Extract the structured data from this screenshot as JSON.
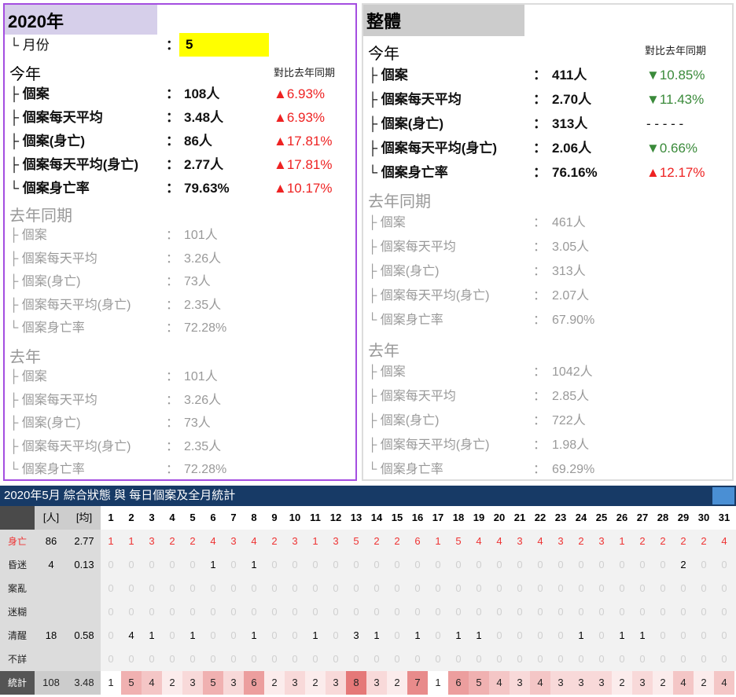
{
  "left": {
    "title": "2020年",
    "month_label": "└ 月份",
    "month_value": "5",
    "this_year": {
      "header": "今年",
      "compare_header": "對比去年同期",
      "rows": [
        {
          "label": "├ 個案",
          "value": "108人",
          "cmp": "▲6.93%",
          "dir": "up"
        },
        {
          "label": "├ 個案每天平均",
          "value": "3.48人",
          "cmp": "▲6.93%",
          "dir": "up"
        },
        {
          "label": "├ 個案(身亡)",
          "value": "86人",
          "cmp": "▲17.81%",
          "dir": "up"
        },
        {
          "label": "├ 個案每天平均(身亡)",
          "value": "2.77人",
          "cmp": "▲17.81%",
          "dir": "up"
        },
        {
          "label": "└ 個案身亡率",
          "value": "79.63%",
          "cmp": "▲10.17%",
          "dir": "up"
        }
      ]
    },
    "same_period": {
      "header": "去年同期",
      "rows": [
        {
          "label": "├ 個案",
          "value": "101人"
        },
        {
          "label": "├ 個案每天平均",
          "value": "3.26人"
        },
        {
          "label": "├ 個案(身亡)",
          "value": "73人"
        },
        {
          "label": "├ 個案每天平均(身亡)",
          "value": "2.35人"
        },
        {
          "label": "└ 個案身亡率",
          "value": "72.28%"
        }
      ]
    },
    "last_year": {
      "header": "去年",
      "rows": [
        {
          "label": "├ 個案",
          "value": "101人"
        },
        {
          "label": "├ 個案每天平均",
          "value": "3.26人"
        },
        {
          "label": "├ 個案(身亡)",
          "value": "73人"
        },
        {
          "label": "├ 個案每天平均(身亡)",
          "value": "2.35人"
        },
        {
          "label": "└ 個案身亡率",
          "value": "72.28%"
        }
      ]
    }
  },
  "right": {
    "title": "整體",
    "this_year": {
      "header": "今年",
      "compare_header": "對比去年同期",
      "rows": [
        {
          "label": "├ 個案",
          "value": "411人",
          "cmp": "▼10.85%",
          "dir": "down"
        },
        {
          "label": "├ 個案每天平均",
          "value": "2.70人",
          "cmp": "▼11.43%",
          "dir": "down"
        },
        {
          "label": "├ 個案(身亡)",
          "value": "313人",
          "cmp": "- - - - -",
          "dir": "dash"
        },
        {
          "label": "├ 個案每天平均(身亡)",
          "value": "2.06人",
          "cmp": "▼0.66%",
          "dir": "down"
        },
        {
          "label": "└ 個案身亡率",
          "value": "76.16%",
          "cmp": "▲12.17%",
          "dir": "up"
        }
      ]
    },
    "same_period": {
      "header": "去年同期",
      "rows": [
        {
          "label": "├ 個案",
          "value": "461人"
        },
        {
          "label": "├ 個案每天平均",
          "value": "3.05人"
        },
        {
          "label": "├ 個案(身亡)",
          "value": "313人"
        },
        {
          "label": "├ 個案每天平均(身亡)",
          "value": "2.07人"
        },
        {
          "label": "└ 個案身亡率",
          "value": "67.90%"
        }
      ]
    },
    "last_year": {
      "header": "去年",
      "rows": [
        {
          "label": "├ 個案",
          "value": "1042人"
        },
        {
          "label": "├ 個案每天平均",
          "value": "2.85人"
        },
        {
          "label": "├ 個案(身亡)",
          "value": "722人"
        },
        {
          "label": "├ 個案每天平均(身亡)",
          "value": "1.98人"
        },
        {
          "label": "└ 個案身亡率",
          "value": "69.29%"
        }
      ]
    }
  },
  "colon": "：",
  "table": {
    "title": "2020年5月 綜合狀態 與 每日個案及全月統計",
    "col_people": "[人]",
    "col_avg": "[均]",
    "days": [
      "1",
      "2",
      "3",
      "4",
      "5",
      "6",
      "7",
      "8",
      "9",
      "10",
      "11",
      "12",
      "13",
      "14",
      "15",
      "16",
      "17",
      "18",
      "19",
      "20",
      "21",
      "22",
      "23",
      "24",
      "25",
      "26",
      "27",
      "28",
      "29",
      "30",
      "31"
    ],
    "rows": [
      {
        "label": "身亡",
        "people": "86",
        "avg": "2.77",
        "style": "red",
        "values": [
          1,
          1,
          3,
          2,
          2,
          4,
          3,
          4,
          2,
          3,
          1,
          3,
          5,
          2,
          2,
          6,
          1,
          5,
          4,
          4,
          3,
          4,
          3,
          2,
          3,
          1,
          2,
          2,
          2,
          2,
          4
        ]
      },
      {
        "label": "昏迷",
        "people": "4",
        "avg": "0.13",
        "style": "normal",
        "values": [
          0,
          0,
          0,
          0,
          0,
          1,
          0,
          1,
          0,
          0,
          0,
          0,
          0,
          0,
          0,
          0,
          0,
          0,
          0,
          0,
          0,
          0,
          0,
          0,
          0,
          0,
          0,
          0,
          2,
          0,
          0
        ]
      },
      {
        "label": "案亂",
        "people": "",
        "avg": "",
        "style": "normal",
        "values": [
          0,
          0,
          0,
          0,
          0,
          0,
          0,
          0,
          0,
          0,
          0,
          0,
          0,
          0,
          0,
          0,
          0,
          0,
          0,
          0,
          0,
          0,
          0,
          0,
          0,
          0,
          0,
          0,
          0,
          0,
          0
        ]
      },
      {
        "label": "迷糊",
        "people": "",
        "avg": "",
        "style": "normal",
        "values": [
          0,
          0,
          0,
          0,
          0,
          0,
          0,
          0,
          0,
          0,
          0,
          0,
          0,
          0,
          0,
          0,
          0,
          0,
          0,
          0,
          0,
          0,
          0,
          0,
          0,
          0,
          0,
          0,
          0,
          0,
          0
        ]
      },
      {
        "label": "清醒",
        "people": "18",
        "avg": "0.58",
        "style": "normal",
        "values": [
          0,
          4,
          1,
          0,
          1,
          0,
          0,
          1,
          0,
          0,
          1,
          0,
          3,
          1,
          0,
          1,
          0,
          1,
          1,
          0,
          0,
          0,
          0,
          1,
          0,
          1,
          1,
          0,
          0,
          0,
          0
        ]
      },
      {
        "label": "不詳",
        "people": "",
        "avg": "",
        "style": "normal",
        "values": [
          0,
          0,
          0,
          0,
          0,
          0,
          0,
          0,
          0,
          0,
          0,
          0,
          0,
          0,
          0,
          0,
          0,
          0,
          0,
          0,
          0,
          0,
          0,
          0,
          0,
          0,
          0,
          0,
          0,
          0,
          0
        ]
      },
      {
        "label": "統計",
        "people": "108",
        "avg": "3.48",
        "style": "stat",
        "values": [
          1,
          5,
          4,
          2,
          3,
          5,
          3,
          6,
          2,
          3,
          2,
          3,
          8,
          3,
          2,
          7,
          1,
          6,
          5,
          4,
          3,
          4,
          3,
          3,
          3,
          2,
          3,
          2,
          4,
          2,
          4
        ]
      }
    ],
    "heat_color": "#e06060"
  }
}
